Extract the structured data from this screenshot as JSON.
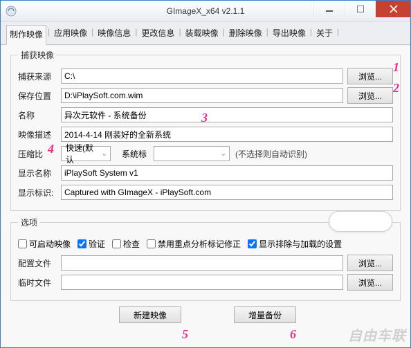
{
  "window": {
    "title": "GImageX_x64 v2.1.1"
  },
  "tabs": {
    "items": [
      "制作映像",
      "应用映像",
      "映像信息",
      "更改信息",
      "装载映像",
      "删除映像",
      "导出映像",
      "关于"
    ],
    "active_index": 0
  },
  "capture_group": {
    "legend": "捕获映像",
    "source_label": "捕获来源",
    "source_value": "C:\\",
    "browse": "浏览...",
    "save_label": "保存位置",
    "save_value": "D:\\iPlaySoft.com.wim",
    "name_label": "名称",
    "name_value": "异次元软件 - 系统备份",
    "desc_label": "映像描述",
    "desc_value": "2014-4-14 刚装好的全新系统",
    "compress_label": "压缩比",
    "compress_value": "快速(默认",
    "flag_label": "系统标",
    "flag_value": "",
    "flag_hint": "(不选择则自动识别)",
    "dispname_label": "显示名称",
    "dispname_value": "iPlaySoft System v1",
    "dispmark_label": "显示标识:",
    "dispmark_value": "Captured with GImageX - iPlaySoft.com"
  },
  "options_group": {
    "legend": "选项",
    "bootable": "可启动映像",
    "verify": "验证",
    "check": "检查",
    "disable_rp": "禁用重点分析标记修正",
    "show_excl": "显示排除与加载的设置",
    "checked": {
      "bootable": false,
      "verify": true,
      "check": false,
      "disable_rp": false,
      "show_excl": true
    },
    "config_label": "配置文件",
    "config_value": "",
    "temp_label": "临时文件",
    "temp_value": "",
    "browse": "浏览..."
  },
  "actions": {
    "create": "新建映像",
    "append": "增量备份"
  },
  "annotations": {
    "a1": "1",
    "a2": "2",
    "a3": "3",
    "a4": "4",
    "a5": "5",
    "a6": "6"
  },
  "watermark": "自由车联"
}
